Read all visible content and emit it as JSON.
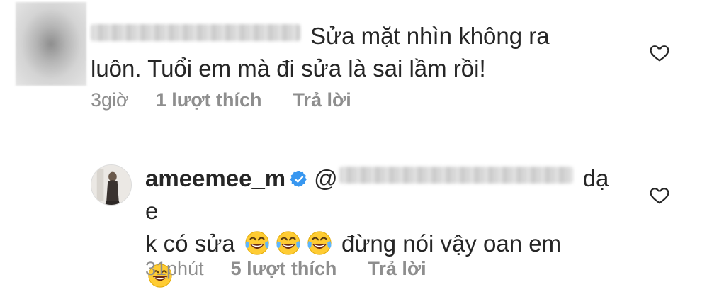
{
  "comments": [
    {
      "text_line1": "Sửa mặt nhìn không ra",
      "text_line2": "luôn. Tuổi em mà đi sửa là sai lầm rồi!",
      "time": "3giờ",
      "likes": "1 lượt thích",
      "reply": "Trả lời"
    },
    {
      "username": "ameemee_m",
      "text_part1": "dạ e",
      "text_part2_a": "k có sửa",
      "text_part2_b": "đừng nói vậy oan em",
      "mention_prefix": "@",
      "time": "31phút",
      "likes": "5 lượt thích",
      "reply": "Trả lời"
    }
  ],
  "icons": {
    "like": "heart-outline-icon",
    "verified": "verified-badge-icon",
    "emoji_laugh": "tears-of-joy-emoji",
    "emoji_grin": "grinning-face-emoji"
  },
  "colors": {
    "text": "#262626",
    "meta": "#8e8e8e",
    "verified": "#3897f0"
  }
}
